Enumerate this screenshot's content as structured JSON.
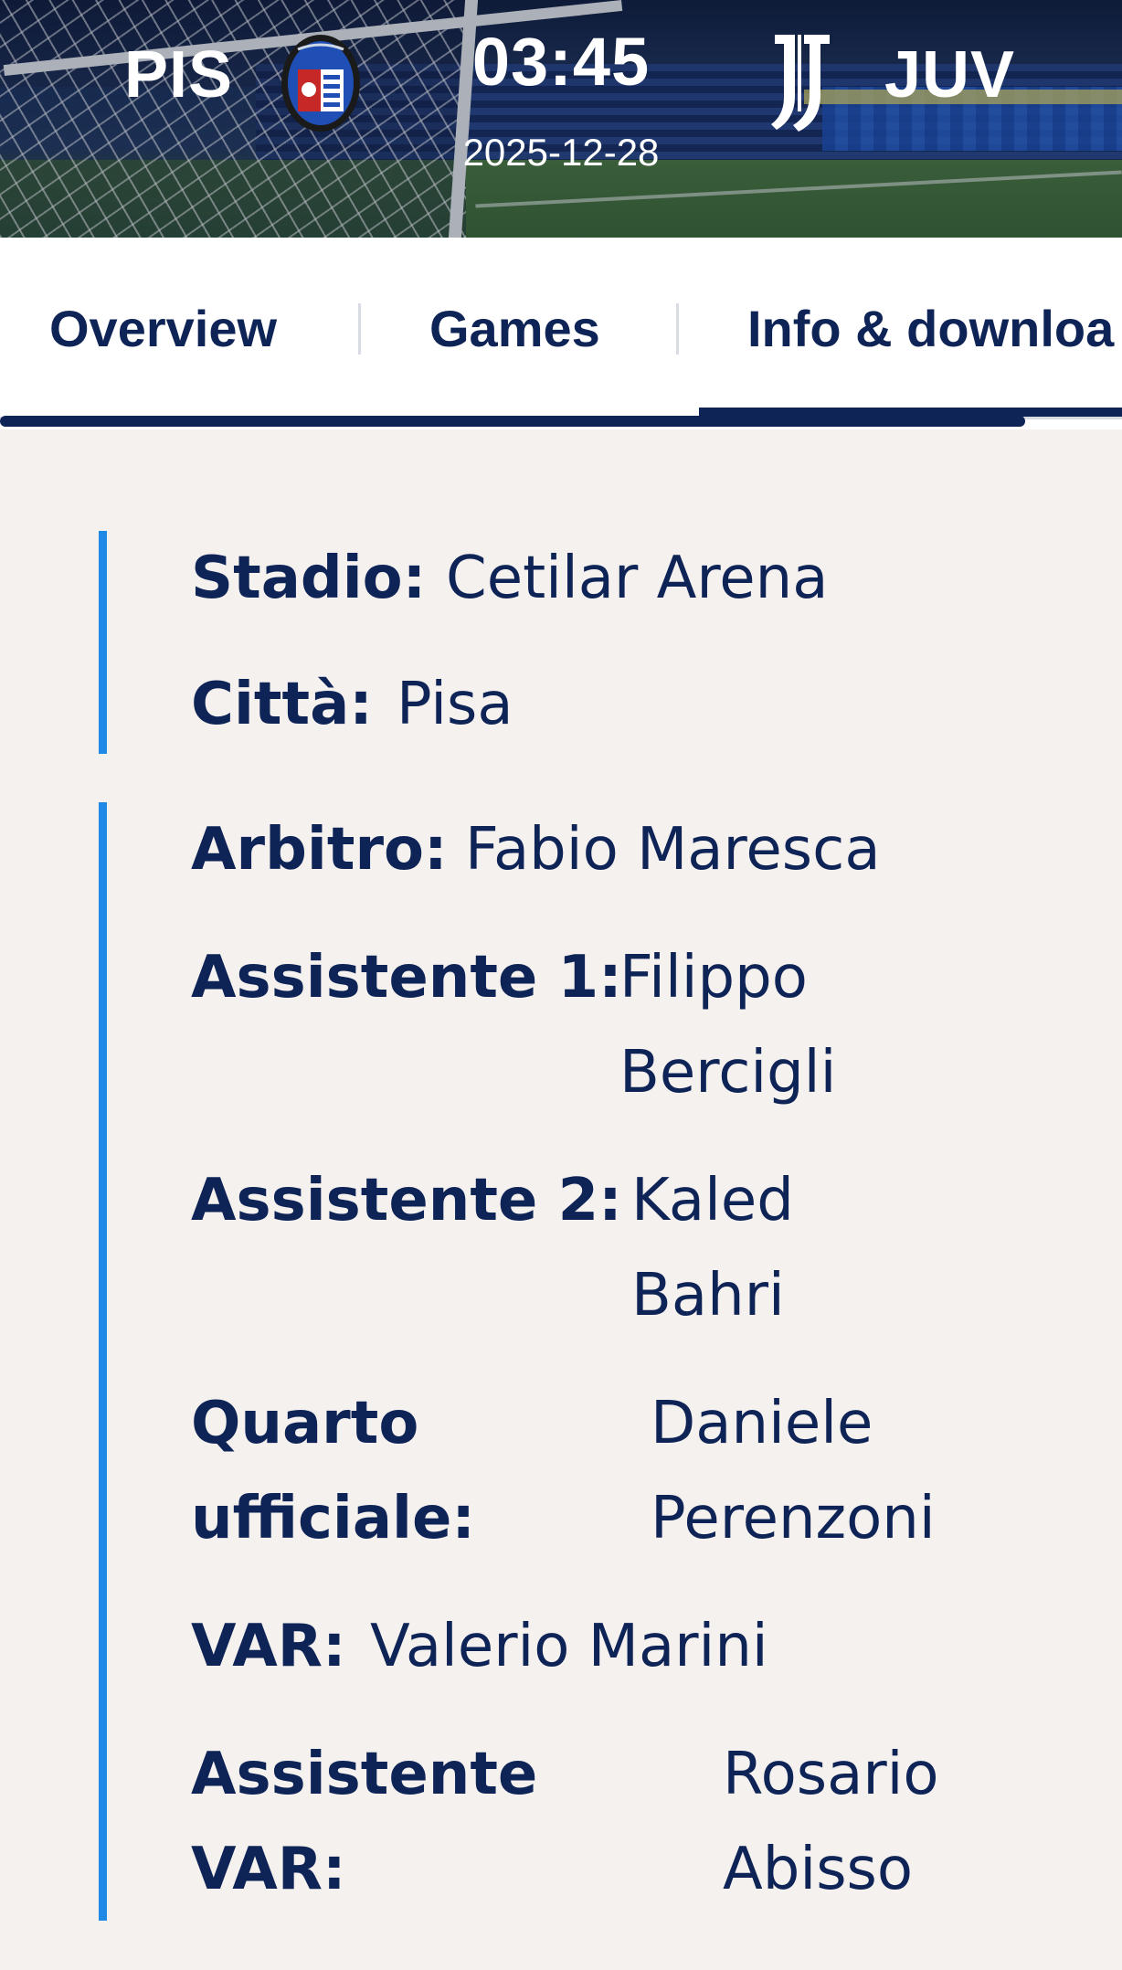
{
  "match": {
    "home_code": "PIS",
    "away_code": "JUV",
    "time": "03:45",
    "date": "2025-12-28"
  },
  "tabs": [
    "Overview",
    "Games",
    "Info & downloa"
  ],
  "venue": {
    "stadium_label": "Stadio:",
    "stadium_value": "Cetilar Arena",
    "city_label": "Città:",
    "city_value": "Pisa"
  },
  "officials": {
    "referee_label": "Arbitro:",
    "referee_value": "Fabio Maresca",
    "assistant1_label": "Assistente 1:",
    "assistant1_value_l1": "Filippo",
    "assistant1_value_l2": "Bercigli",
    "assistant2_label": "Assistente 2:",
    "assistant2_value_l1": "Kaled",
    "assistant2_value_l2": "Bahri",
    "fourth_label_l1": "Quarto",
    "fourth_label_l2": "ufficiale:",
    "fourth_value_l1": "Daniele",
    "fourth_value_l2": "Perenzoni",
    "var_label": "VAR:",
    "var_value": "Valerio Marini",
    "avar_label_l1": "Assistente",
    "avar_label_l2": "VAR:",
    "avar_value_l1": "Rosario",
    "avar_value_l2": "Abisso"
  },
  "colors": {
    "navy": "#0e2356",
    "accent_blue": "#1e8ae6",
    "background": "#f5f1ef"
  }
}
